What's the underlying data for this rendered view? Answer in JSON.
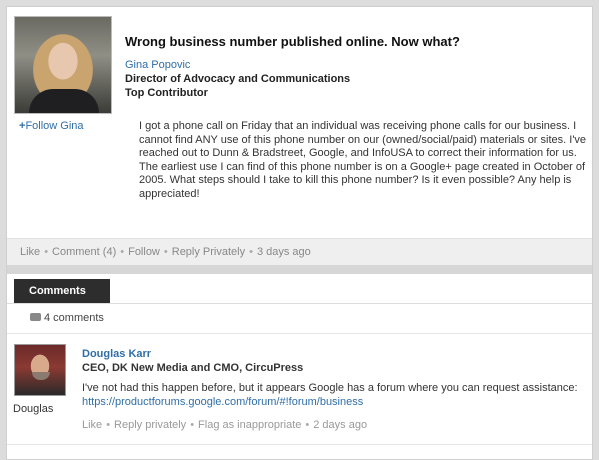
{
  "post": {
    "title": "Wrong business number published online. Now what?",
    "author_name": "Gina Popovic",
    "author_role": "Director of Advocacy and Communications",
    "author_badge": "Top Contributor",
    "follow_label": "Follow Gina",
    "body": "I got a phone call on Friday that an individual was receiving phone calls for our business. I cannot find ANY use of this phone number on our (owned/social/paid) materials or sites. I've reached out to Dunn & Bradstreet, Google, and InfoUSA to correct their information for us. The earliest use I can find of this phone number is on a Google+ page created in October of 2005. What steps should I take to kill this phone number? Is it even possible? Any help is appreciated!",
    "actions": {
      "like": "Like",
      "comment": "Comment (4)",
      "follow": "Follow",
      "reply_privately": "Reply Privately",
      "time": "3 days ago"
    }
  },
  "comments": {
    "tab_label": "Comments",
    "count_label": "4 comments",
    "items": [
      {
        "name": "Douglas Karr",
        "avatar_caption": "Douglas",
        "role": "CEO, DK New Media and CMO, CircuPress",
        "body": "I've not had this happen before, but it appears Google has a forum where you can request assistance: ",
        "link": "https://productforums.google.com/forum/#!forum/business",
        "actions": {
          "like": "Like",
          "reply_privately": "Reply privately",
          "flag": "Flag as inappropriate",
          "time": "2 days ago"
        }
      }
    ]
  },
  "colors": {
    "link": "#2f6ea8",
    "tab_bg": "#2d2d2d",
    "action_bar_bg": "#efefef"
  }
}
